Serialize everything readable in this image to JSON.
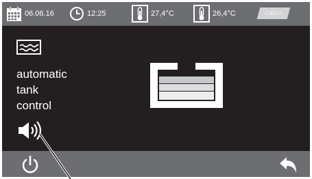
{
  "status_bar": {
    "date": "06.06.16",
    "time": "12:25",
    "temperature_1": "27,4°C",
    "temperature_2": "26,4°C",
    "logo_text": "CIBUS"
  },
  "main": {
    "mode_label": "automatic\ntank\ncontrol"
  },
  "icons": {
    "calendar": "calendar-icon",
    "clock": "clock-icon",
    "thermometer_1": "thermometer-icon",
    "thermometer_2": "thermometer-icon",
    "tank_mode": "tank-waves-icon",
    "speaker": "speaker-icon",
    "tank": "tank-level-icon",
    "power": "power-icon",
    "back": "back-arrow-icon"
  },
  "colors": {
    "screen_background": "#231f20",
    "bar_background": "#6d6e71",
    "foreground": "#ffffff",
    "logo_background": "#d1d3d4"
  }
}
